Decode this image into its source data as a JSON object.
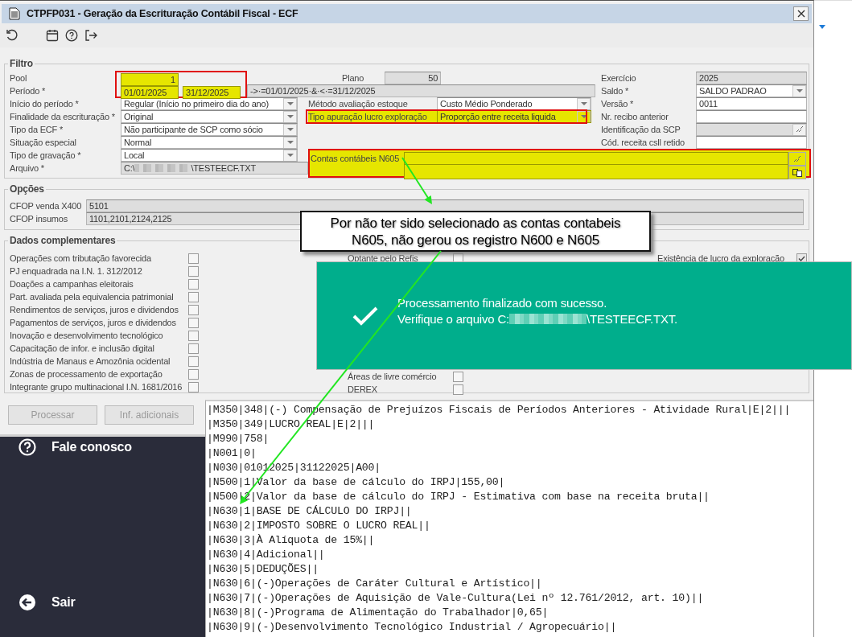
{
  "window": {
    "title": "CTPFP031 - Geração da Escrituração Contábil Fiscal - ECF"
  },
  "filtro": {
    "title": "Filtro",
    "pool": {
      "label": "Pool",
      "value": "1",
      "kind": "input",
      "highlighted": true
    },
    "periodo": {
      "label": "Período *",
      "from": "01/01/2025",
      "to": "31/12/2025",
      "highlighted": true,
      "expression": "->·=01/01/2025·&·<·=31/12/2025"
    },
    "plano": {
      "label": "Plano",
      "value": "50",
      "kind": "input",
      "highlighted": false,
      "disabled": true
    },
    "exercicio": {
      "label": "Exercício",
      "value": "2025",
      "kind": "input",
      "highlighted": false,
      "disabled": true
    },
    "saldo": {
      "label": "Saldo *",
      "value": "SALDO PADRAO",
      "kind": "select",
      "highlighted": false,
      "disabled": false
    },
    "inicio": {
      "label": "Início do período *",
      "value": "Regular (Início no primeiro dia do ano)",
      "kind": "select",
      "highlighted": false,
      "disabled": false
    },
    "metodo": {
      "label": "Método avaliação estoque",
      "value": "Custo Médio Ponderado",
      "kind": "select",
      "highlighted": false,
      "disabled": false
    },
    "versao": {
      "label": "Versão *",
      "value": "0011",
      "kind": "input",
      "highlighted": false,
      "disabled": false
    },
    "finalidade": {
      "label": "Finalidade da escrituração *",
      "value": "Original",
      "kind": "select",
      "highlighted": false,
      "disabled": false
    },
    "tipo_apuracao": {
      "label": "Tipo apuração lucro exploração",
      "value": "Proporção entre receita liquida",
      "kind": "select",
      "highlighted": true
    },
    "nr_recibo": {
      "label": "Nr. recibo anterior",
      "kind": "input",
      "highlighted": false,
      "disabled": false
    },
    "tipo_ecf": {
      "label": "Tipo da ECF *",
      "value": "Não participante de SCP como sócio",
      "kind": "select",
      "highlighted": false,
      "disabled": false
    },
    "identificacao_scp": {
      "label": "Identificação da SCP",
      "kind": "lookup",
      "highlighted": false,
      "disabled": true
    },
    "situacao": {
      "label": "Situação especial",
      "value": "Normal",
      "kind": "select",
      "highlighted": false,
      "disabled": false
    },
    "cod_receita": {
      "label": "Cód. receita csll retido",
      "kind": "input",
      "highlighted": false,
      "disabled": false
    },
    "tipo_gravacao": {
      "label": "Tipo de gravação *",
      "value": "Local",
      "kind": "select",
      "highlighted": false,
      "disabled": false
    },
    "contas": {
      "label": "Contas contábeis N605",
      "kind": "lookup",
      "highlighted": true
    },
    "arquivo": {
      "label": "Arquivo *",
      "value_start": "C:\\",
      "value_end": "\\TESTEECF.TXT",
      "redacted": true,
      "disabled": true
    }
  },
  "opcoes": {
    "title": "Opções",
    "fields": [
      {
        "label": "CFOP venda X400",
        "value": "5101"
      },
      {
        "label": "CFOP insumos",
        "value": "1101,2101,2124,2125"
      }
    ]
  },
  "dados": {
    "title": "Dados complementares",
    "left": [
      {
        "label": "Operações com tributação favorecida",
        "checked": false
      },
      {
        "label": "PJ enquadrada na I.N. 1. 312/2012",
        "checked": false
      },
      {
        "label": "Doações a campanhas eleitorais",
        "checked": false
      },
      {
        "label": "Part. avaliada pela equivalencia patrimonial",
        "checked": false
      },
      {
        "label": "Rendimentos de serviços, juros e dividendos",
        "checked": false
      },
      {
        "label": "Pagamentos de serviços, juros e dividendos",
        "checked": false
      },
      {
        "label": "Inovação e desenvolvimento tecnológico",
        "checked": false
      },
      {
        "label": "Capacitação de infor. e inclusão digital",
        "checked": false
      },
      {
        "label": "Indústria de Manaus e Amozônia ocidental",
        "checked": false
      },
      {
        "label": "Zonas de processamento de exportação",
        "checked": false
      },
      {
        "label": "Integrante grupo multinacional I.N. 1681/2016",
        "checked": false
      }
    ],
    "middle": [
      {
        "label": "Optante pelo Refis",
        "checked": false
      },
      {
        "label": "Áreas de livre comércio",
        "checked": false
      },
      {
        "label": "DEREX",
        "checked": false
      }
    ],
    "right": [
      {
        "label": "Existência de lucro da exploração",
        "checked": true
      }
    ]
  },
  "buttons": [
    {
      "label": "Processar",
      "disabled": true
    },
    {
      "label": "Inf. adicionais",
      "disabled": true
    }
  ],
  "callout": {
    "lines": [
      "Por não ter sido selecionado as contas contabeis",
      "N605, não gerou os registro N600 e N605"
    ]
  },
  "toast": {
    "message": "Processamento finalizado com sucesso.",
    "file_prefix": "Verifique o arquivo C:",
    "file_suffix": "\\TESTEECF.TXT.",
    "redacted": true
  },
  "sidebar": {
    "items": [
      {
        "label": "Fale conosco",
        "kind": "help"
      },
      {
        "label": "Sair",
        "kind": "exit"
      }
    ]
  },
  "file_lines": [
    "|M350|348|(-) Compensação de Prejuízos Fiscais de Períodos Anteriores - Atividade Rural|E|2|||",
    "|M350|349|LUCRO REAL|E|2|||",
    "|M990|758|",
    "|N001|0|",
    "|N030|01012025|31122025|A00|",
    "|N500|1|Valor da base de cálculo do IRPJ|155,00|",
    "|N500|2|Valor da base de cálculo do IRPJ - Estimativa com base na receita bruta||",
    "|N630|1|BASE DE CÁLCULO DO IRPJ||",
    "|N630|2|IMPOSTO SOBRE O LUCRO REAL||",
    "|N630|3|À Alíquota de 15%||",
    "|N630|4|Adicional||",
    "|N630|5|DEDUÇÕES||",
    "|N630|6|(-)Operações de Caráter Cultural e Artístico||",
    "|N630|7|(-)Operações de Aquisição de Vale-Cultura(Lei nº 12.761/2012, art. 10)||",
    "|N630|8|(-)Programa de Alimentação do Trabalhador|0,65|",
    "|N630|9|(-)Desenvolvimento Tecnológico Industrial / Agropecuário||"
  ]
}
